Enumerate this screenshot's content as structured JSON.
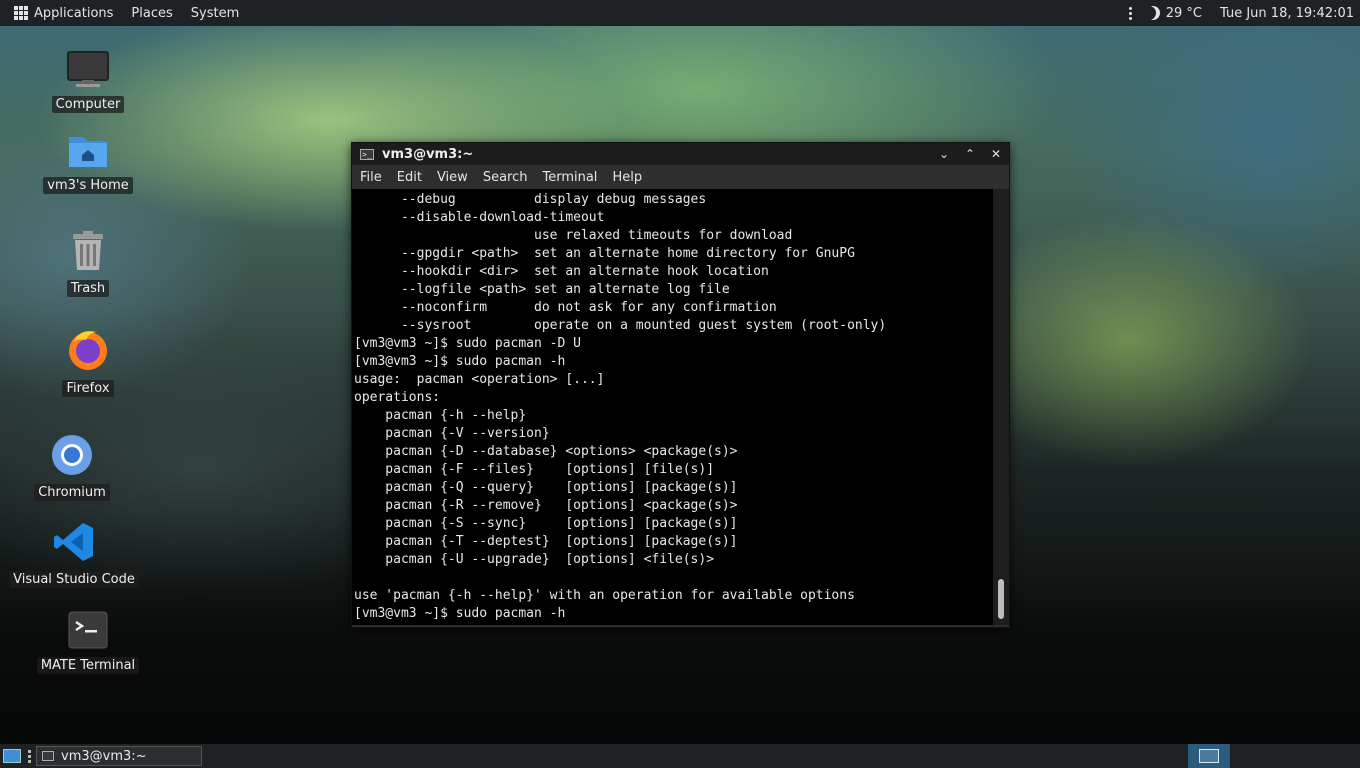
{
  "top_panel": {
    "menus": [
      "Applications",
      "Places",
      "System"
    ],
    "temperature": "29 °C",
    "clock": "Tue Jun 18, 19:42:01",
    "icons": [
      "apps-grid-icon",
      "kebab-menu-icon",
      "moon-icon"
    ]
  },
  "desktop_icons": [
    {
      "label": "Computer",
      "icon": "monitor-icon"
    },
    {
      "label": "vm3's Home",
      "icon": "home-folder-icon"
    },
    {
      "label": "Trash",
      "icon": "trash-icon"
    },
    {
      "label": "Firefox",
      "icon": "firefox-icon"
    },
    {
      "label": "Chromium",
      "icon": "chromium-icon"
    },
    {
      "label": "Visual Studio Code",
      "icon": "vscode-icon"
    },
    {
      "label": "MATE Terminal",
      "icon": "terminal-icon"
    }
  ],
  "terminal": {
    "title": "vm3@vm3:~",
    "window_buttons": [
      "v",
      "^",
      "x"
    ],
    "menu": [
      "File",
      "Edit",
      "View",
      "Search",
      "Terminal",
      "Help"
    ],
    "lines": [
      "      --debug          display debug messages",
      "      --disable-download-timeout",
      "                       use relaxed timeouts for download",
      "      --gpgdir <path>  set an alternate home directory for GnuPG",
      "      --hookdir <dir>  set an alternate hook location",
      "      --logfile <path> set an alternate log file",
      "      --noconfirm      do not ask for any confirmation",
      "      --sysroot        operate on a mounted guest system (root-only)",
      "[vm3@vm3 ~]$ sudo pacman -D U",
      "[vm3@vm3 ~]$ sudo pacman -h",
      "usage:  pacman <operation> [...]",
      "operations:",
      "    pacman {-h --help}",
      "    pacman {-V --version}",
      "    pacman {-D --database} <options> <package(s)>",
      "    pacman {-F --files}    [options] [file(s)]",
      "    pacman {-Q --query}    [options] [package(s)]",
      "    pacman {-R --remove}   [options] <package(s)>",
      "    pacman {-S --sync}     [options] [package(s)]",
      "    pacman {-T --deptest}  [options] [package(s)]",
      "    pacman {-U --upgrade}  [options] <file(s)>",
      "",
      "use 'pacman {-h --help}' with an operation for available options",
      "[vm3@vm3 ~]$ sudo pacman -h"
    ]
  },
  "taskbar": {
    "task_label": "vm3@vm3:~"
  }
}
